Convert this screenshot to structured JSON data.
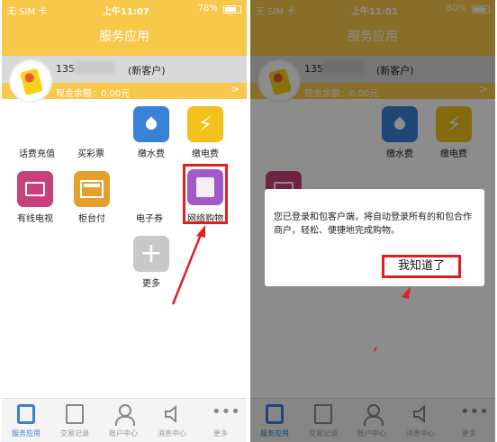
{
  "status_left": {
    "carrier": "无 SIM 卡",
    "time": "上午11:07",
    "battery": "78%",
    "battery_fraction": 0.78
  },
  "status_right": {
    "carrier": "无 SIM 卡",
    "time": "上午11:01",
    "battery": "80%",
    "battery_fraction": 0.8
  },
  "header": {
    "title": "服务应用"
  },
  "account": {
    "phone_prefix": "135",
    "customer_type": "(新客户)",
    "balance": "现金余额：0.00元"
  },
  "services": {
    "phone_recharge": "话费充值",
    "lottery": "买彩票",
    "water_bill": "缴水费",
    "electric_bill": "缴电费",
    "cable_tv": "有线电视",
    "counter_pay": "柜台付",
    "e_coupon": "电子券",
    "online_shopping": "网络购物",
    "more": "更多"
  },
  "dialog": {
    "message": "您已登录和包客户端，将自动登录所有的和包合作商户，轻松、便捷地完成购物。",
    "ok_button": "我知道了"
  },
  "tabbar": [
    "服务应用",
    "交易记录",
    "账户中心",
    "消息中心",
    "更多"
  ],
  "colors": {
    "brand_yellow": "#f7c84a",
    "highlight_red": "#e02020",
    "active_blue": "#3a7fd5"
  }
}
